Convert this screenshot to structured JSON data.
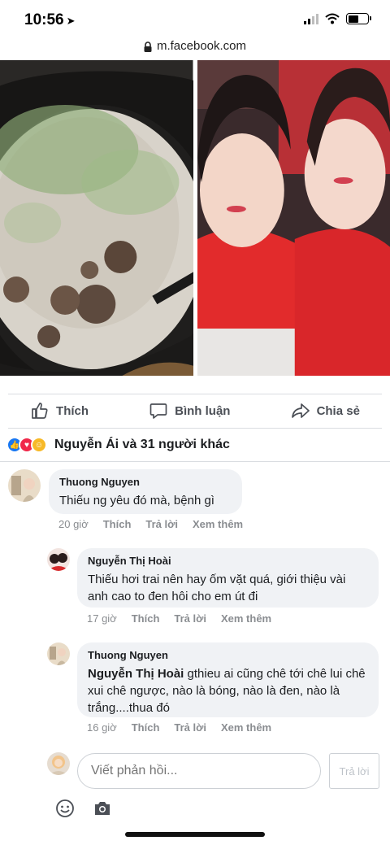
{
  "status": {
    "time": "10:56",
    "location_icon": "location-arrow-icon"
  },
  "browser": {
    "url": "m.facebook.com"
  },
  "actions": {
    "like": "Thích",
    "comment": "Bình luận",
    "share": "Chia sẻ"
  },
  "reactions": {
    "summary": "Nguyễn Ái và 31 người khác"
  },
  "comments": [
    {
      "author": "Thuong Nguyen",
      "text": "Thiếu ng yêu đó mà, bệnh gì",
      "time": "20 giờ",
      "like": "Thích",
      "reply": "Trả lời",
      "more": "Xem thêm"
    },
    {
      "author": "Nguyễn Thị Hoài",
      "text": "Thiếu hơi trai nên hay ốm vặt quá, giới thiệu vài anh cao to đen hôi cho em út đi",
      "time": "17 giờ",
      "like": "Thích",
      "reply": "Trả lời",
      "more": "Xem thêm"
    },
    {
      "author": "Thuong Nguyen",
      "mention": "Nguyễn Thị Hoài",
      "text": " gthieu ai cũng chê tới chê lui chê xui chê ngược, nào là bóng, nào là đen, nào là trắng....thua đó",
      "time": "16 giờ",
      "like": "Thích",
      "reply": "Trả lời",
      "more": "Xem thêm"
    }
  ],
  "reply": {
    "placeholder": "Viết phản hồi...",
    "button": "Trả lời"
  },
  "colors": {
    "facebook_blue": "#1877f2",
    "love_red": "#f0284a",
    "haha_yellow": "#f7b928"
  }
}
